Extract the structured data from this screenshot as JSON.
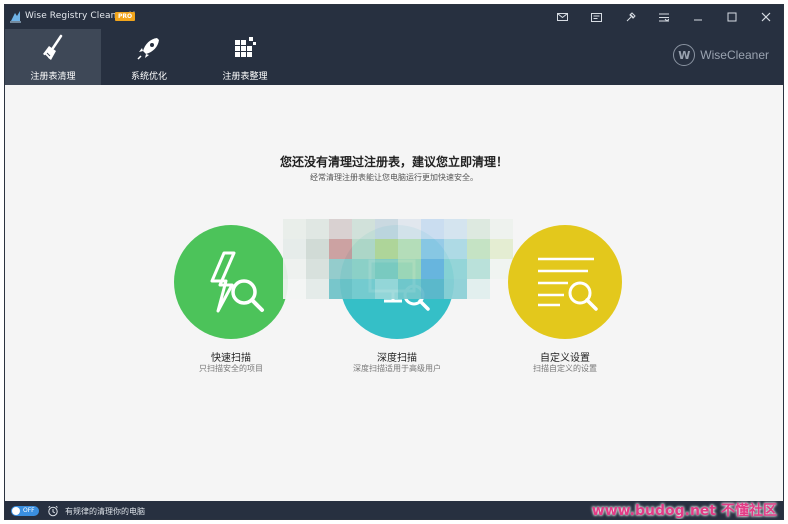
{
  "titlebar": {
    "app_title": "Wise Registry Cleaner X",
    "pro_badge": "PRO",
    "icons": [
      "mail-icon",
      "feedback-icon",
      "skin-icon",
      "menu-icon",
      "minimize-icon",
      "maximize-icon",
      "close-icon"
    ]
  },
  "nav": {
    "tabs": [
      {
        "label": "注册表清理",
        "icon": "broom-icon",
        "active": true
      },
      {
        "label": "系统优化",
        "icon": "rocket-icon",
        "active": false
      },
      {
        "label": "注册表整理",
        "icon": "blocks-icon",
        "active": false
      }
    ],
    "brand_logo": "W",
    "brand": "WiseCleaner"
  },
  "main": {
    "headline": "您还没有清理过注册表，建议您立即清理！",
    "subline": "经常清理注册表能让您电脑运行更加快速安全。",
    "scans": [
      {
        "label": "快速扫描",
        "desc": "只扫描安全的项目",
        "color": "#4cc35a",
        "icon": "lightning-search-icon"
      },
      {
        "label": "深度扫描",
        "desc": "深度扫描适用于高级用户",
        "color": "#35bfc7",
        "icon": "monitor-search-icon"
      },
      {
        "label": "自定义设置",
        "desc": "扫描自定义的设置",
        "color": "#e3c81c",
        "icon": "list-search-icon"
      }
    ]
  },
  "statusbar": {
    "toggle": "OFF",
    "text": "有规律的清理你的电脑",
    "watermark": "www.budog.net 不懂社区"
  }
}
